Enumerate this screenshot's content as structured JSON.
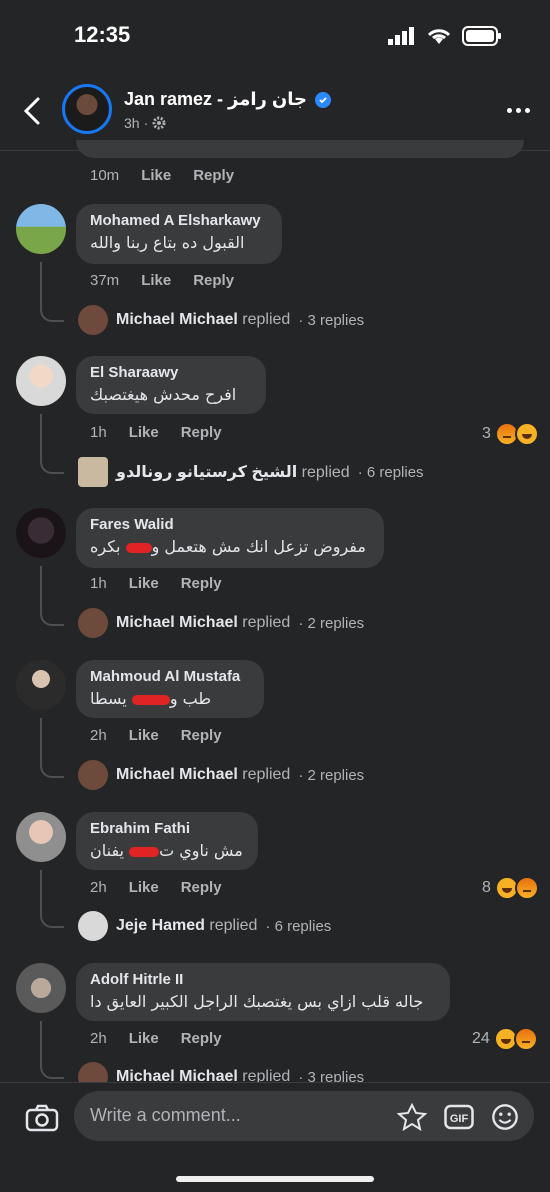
{
  "status": {
    "time": "12:35"
  },
  "header": {
    "name": "Jan ramez - جان رامز",
    "time": "3h",
    "dot": "·"
  },
  "top_meta": {
    "time": "10m",
    "like": "Like",
    "reply": "Reply"
  },
  "comments": [
    {
      "name": "Mohamed A Elsharkawy",
      "text": "القبول ده بتاع ربنا والله",
      "time": "37m",
      "like": "Like",
      "reply": "Reply",
      "replied_by": "Michael Michael",
      "replied_word": "replied",
      "replies": "· 3 replies",
      "reaction_count": ""
    },
    {
      "name": "El Sharaawy",
      "text": "افرح محدش هيغتصبك",
      "time": "1h",
      "like": "Like",
      "reply": "Reply",
      "replied_by": "الشيخ كرستيانو رونالدو",
      "replied_word": "replied",
      "replies": "· 6 replies",
      "reaction_count": "3"
    },
    {
      "name": "Fares Walid",
      "text_a": "مفروض تزعل انك مش هتعمل و",
      "text_b": " بكره",
      "time": "1h",
      "like": "Like",
      "reply": "Reply",
      "replied_by": "Michael Michael",
      "replied_word": "replied",
      "replies": "· 2 replies",
      "reaction_count": ""
    },
    {
      "name": "Mahmoud Al Mustafa",
      "text_a": "طب و",
      "text_b": " يسطا",
      "time": "2h",
      "like": "Like",
      "reply": "Reply",
      "replied_by": "Michael Michael",
      "replied_word": "replied",
      "replies": "· 2 replies",
      "reaction_count": ""
    },
    {
      "name": "Ebrahim Fathi",
      "text_a": "مش ناوي ت",
      "text_b": " يفنان",
      "time": "2h",
      "like": "Like",
      "reply": "Reply",
      "replied_by": "Jeje Hamed",
      "replied_word": "replied",
      "replies": "· 6 replies",
      "reaction_count": "8"
    },
    {
      "name": "Adolf Hitrle II",
      "text": "جاله قلب ازاي بس يغتصبك الراجل الكبير العايق دا",
      "time": "2h",
      "like": "Like",
      "reply": "Reply",
      "replied_by": "Michael Michael",
      "replied_word": "replied",
      "replies": "· 3 replies",
      "reaction_count": "24"
    }
  ],
  "composer": {
    "placeholder": "Write a comment..."
  },
  "colors": {
    "background": "#242526",
    "bubble": "#3a3b3c",
    "accent": "#1877f2",
    "redaction": "#e02424"
  }
}
